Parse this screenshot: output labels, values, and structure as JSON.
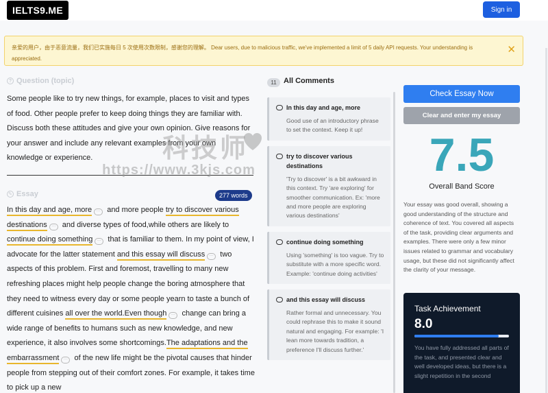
{
  "header": {
    "logo": "IELTS9.ME",
    "signin_label": "Sign in"
  },
  "notice": {
    "text": "亲爱的用户，由于恶意流量，我们已实施每日 5 次使用次数限制，感谢您的理解。 Dear users, due to malicious traffic, we've implemented a limit of 5 daily API requests. Your understanding is appreciated.",
    "close": "✕"
  },
  "question": {
    "heading": "Question (topic)",
    "text": "Some people like to try new things, for example, places to visit and types of food. Other people prefer to keep doing things they are familiar with. Discuss both these attitudes and give your own opinion. Give reasons for your answer and include any relevant examples from your own knowledge or experience."
  },
  "essay": {
    "heading": "Essay",
    "word_count": "277 words",
    "segments": [
      {
        "text": "In this day and age, more",
        "hl": true,
        "c": true
      },
      {
        "text": " and more people ",
        "hl": false,
        "c": false
      },
      {
        "text": "try to discover various destinations",
        "hl": true,
        "c": true
      },
      {
        "text": " and diverse types of food,while others are likely to ",
        "hl": false,
        "c": false
      },
      {
        "text": "continue doing something",
        "hl": true,
        "c": true
      },
      {
        "text": " that is familiar to them. In my point of view, I advocate for the latter statement ",
        "hl": false,
        "c": false
      },
      {
        "text": "and this essay will discuss",
        "hl": true,
        "c": true
      },
      {
        "text": " two aspects of this problem. First and foremost, travelling to many new refreshing places might help people change the boring atmosphere that they need to witness every day or some people yearn to taste a bunch of different cuisines ",
        "hl": false,
        "c": false
      },
      {
        "text": "all over the world.Even though",
        "hl": true,
        "c": true
      },
      {
        "text": " change can bring a wide range of benefits to humans such as new knowledge, and new experience, it also involves some shortcomings.",
        "hl": false,
        "c": false
      },
      {
        "text": "The adaptations and the embarrassment",
        "hl": true,
        "c": true
      },
      {
        "text": " of the new life might be the pivotal causes that hinder people from stepping out of their comfort zones. For example, it takes time to pick up a new",
        "hl": false,
        "c": false
      }
    ]
  },
  "comments": {
    "count": "11",
    "title": "All Comments",
    "items": [
      {
        "title": "In this day and age, more",
        "body": "Good use of an introductory phrase to set the context. Keep it up!"
      },
      {
        "title": "try to discover various destinations",
        "body": "'Try to discover' is a bit awkward in this context. Try 'are exploring' for smoother communication. Ex: 'more and more people are exploring various destinations'"
      },
      {
        "title": "continue doing something",
        "body": "Using 'something' is too vague. Try to substitute with a more specific word. Example: 'continue doing activities'"
      },
      {
        "title": "and this essay will discuss",
        "body": "Rather formal and unnecessary. You could rephrase this to make it sound natural and engaging. For example: 'I lean more towards tradition, a preference I'll discuss further.'"
      }
    ]
  },
  "result": {
    "check_label": "Check Essay Now",
    "clear_label": "Clear and enter my essay",
    "score": "7.5",
    "score_label": "Overall Band Score",
    "summary": "Your essay was good overall, showing a good understanding of the structure and coherence of text. You covered all aspects of the task, providing clear arguments and examples. There were only a few minor issues related to grammar and vocabulary usage, but these did not significantly affect the clarity of your message."
  },
  "task": {
    "title": "Task Achievement",
    "score": "8.0",
    "progress": 0.89,
    "text": "You have fully addressed all parts of the task, and presented clear and well developed ideas, but there is a slight repetition in the second"
  },
  "watermark": {
    "text": "科技师",
    "url": "https://www.3kjs.com"
  },
  "colors": {
    "primary": "#2f7ef0",
    "score": "#3aa6b9",
    "highlight": "#e8b62c",
    "dark_card": "#0f1a2a"
  }
}
